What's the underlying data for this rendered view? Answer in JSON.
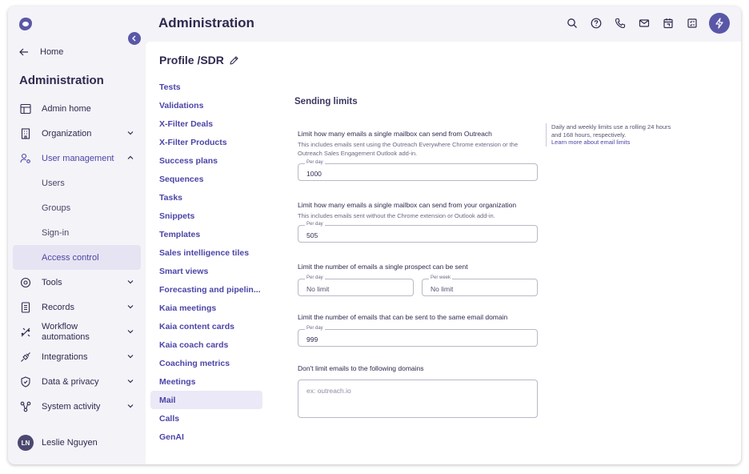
{
  "sidebar": {
    "home_label": "Home",
    "section_title": "Administration",
    "items": [
      {
        "label": "Admin home",
        "icon": "layout-icon"
      },
      {
        "label": "Organization",
        "icon": "building-icon"
      },
      {
        "label": "User management",
        "icon": "user-gear-icon"
      },
      {
        "label": "Users"
      },
      {
        "label": "Groups"
      },
      {
        "label": "Sign-in"
      },
      {
        "label": "Access control"
      },
      {
        "label": "Tools",
        "icon": "tools-icon"
      },
      {
        "label": "Records",
        "icon": "records-icon"
      },
      {
        "label": "Workflow",
        "label2": "automations",
        "icon": "workflow-icon"
      },
      {
        "label": "Integrations",
        "icon": "plug-icon"
      },
      {
        "label": "Data & privacy",
        "icon": "shield-icon"
      },
      {
        "label": "System activity",
        "icon": "activity-icon"
      }
    ],
    "user": {
      "initials": "LN",
      "name": "Leslie Nguyen"
    }
  },
  "header": {
    "title": "Administration"
  },
  "profile": {
    "title": "Profile /SDR"
  },
  "subnav": [
    "Tests",
    "Validations",
    "X-Filter Deals",
    "X-Filter Products",
    "Success plans",
    "Sequences",
    "Tasks",
    "Snippets",
    "Templates",
    "Sales intelligence tiles",
    "Smart views",
    "Forecasting and pipelin...",
    "Kaia meetings",
    "Kaia content cards",
    "Kaia coach cards",
    "Coaching metrics",
    "Meetings",
    "Mail",
    "Calls",
    "GenAI"
  ],
  "form": {
    "section_title": "Sending limits",
    "block1": {
      "title": "Limit how many emails a single mailbox can send from Outreach",
      "desc": "This includes emails sent using the Outreach Everywhere Chrome extension or the Outreach Sales Engagement Outlook add-in.",
      "field_label": "Per day",
      "value": "1000"
    },
    "block2": {
      "title": "Limit how many emails a single mailbox can send from your organization",
      "desc": "This includes emails sent without the Chrome extension or Outlook add-in.",
      "field_label": "Per day",
      "value": "505"
    },
    "block3": {
      "title": "Limit the number of emails a single prospect can be sent",
      "day_label": "Per day",
      "day_value": "No limit",
      "week_label": "Per week",
      "week_value": "No limit"
    },
    "block4": {
      "title": "Limit the number of emails that can be sent to the same email domain",
      "field_label": "Per day",
      "value": "999"
    },
    "block5": {
      "title": "Don't limit emails to the following domains",
      "placeholder": "ex: outreach.io"
    }
  },
  "help": {
    "text": "Daily and weekly limits use a rolling 24 hours and 168 hours, respectively.",
    "link": "Learn more about email limits"
  },
  "colors": {
    "accent": "#4b45a6",
    "brand": "#5a57a8"
  }
}
